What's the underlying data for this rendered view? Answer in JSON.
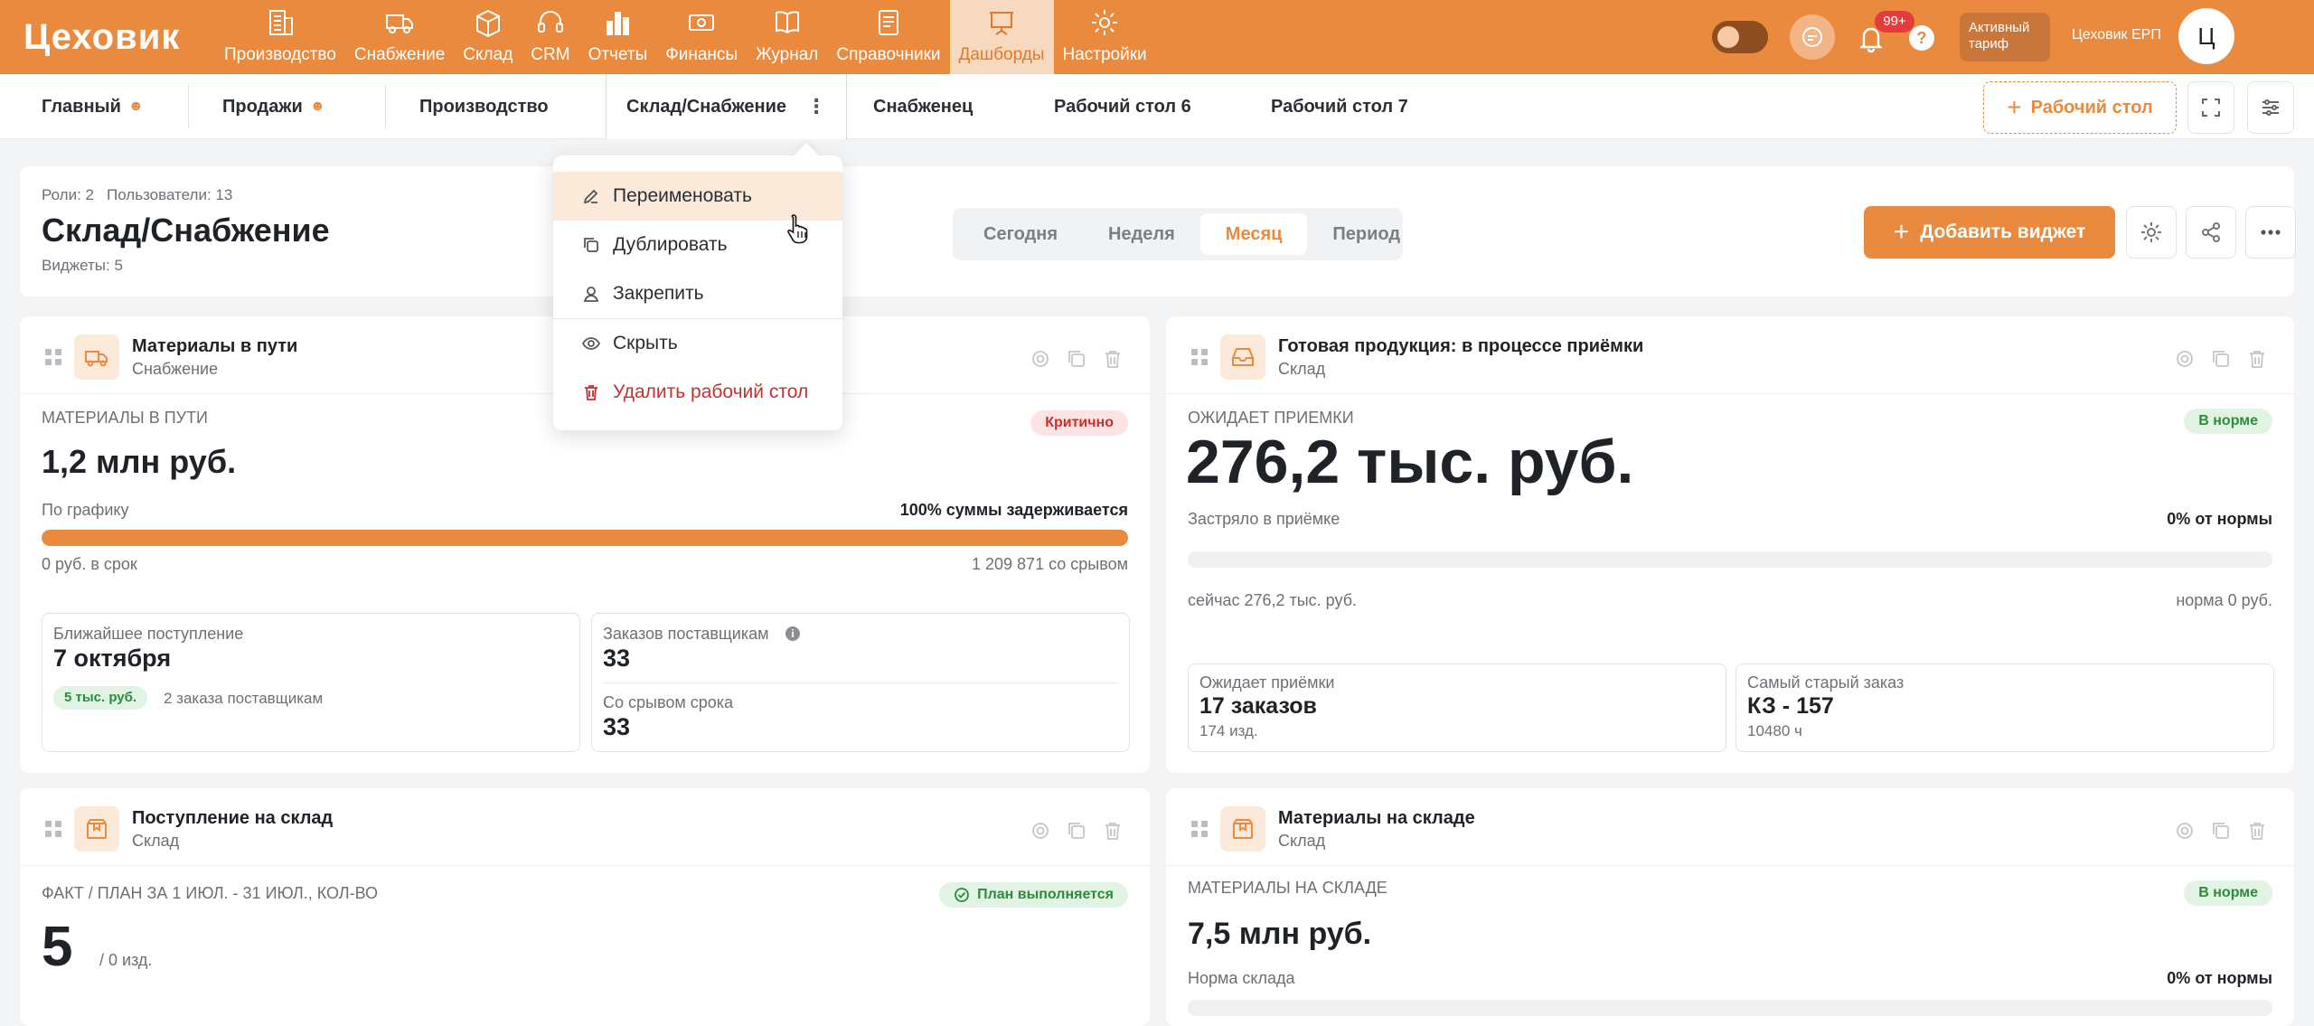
{
  "app": {
    "logo_text": "Цеховик",
    "nav": [
      {
        "label": "Производство",
        "icon": "building-icon"
      },
      {
        "label": "Снабжение",
        "icon": "truck-icon"
      },
      {
        "label": "Склад",
        "icon": "box-icon"
      },
      {
        "label": "CRM",
        "icon": "headset-icon"
      },
      {
        "label": "Отчеты",
        "icon": "bar-chart-icon"
      },
      {
        "label": "Финансы",
        "icon": "money-icon"
      },
      {
        "label": "Журнал",
        "icon": "book-icon"
      },
      {
        "label": "Справочники",
        "icon": "document-icon"
      },
      {
        "label": "Дашборды",
        "icon": "easel-icon",
        "active": true
      },
      {
        "label": "Настройки",
        "icon": "gear-icon"
      }
    ],
    "notifications_badge": "99+",
    "help_label": "?",
    "tariff_label": "Активный тариф",
    "company_name": "Цеховик ЕРП",
    "avatar_letter": "Ц",
    "accent_color": "#e98a3f"
  },
  "tabs": {
    "items": [
      "Главный",
      "Продажи",
      "Производство",
      "Склад/Снабжение",
      "Снабженец",
      "Рабочий стол 6",
      "Рабочий стол 7"
    ],
    "kebab": "⋮",
    "add_label": "Рабочий стол"
  },
  "menu": {
    "items": [
      "Переименовать",
      "Дублировать",
      "Закрепить",
      "Скрыть",
      "Удалить рабочий стол"
    ]
  },
  "header": {
    "roles": "Роли: 2",
    "users": "Пользователи: 13",
    "title": "Склад/Снабжение",
    "widgets_count": "Виджеты: 5",
    "periods": [
      "Сегодня",
      "Неделя",
      "Месяц",
      "Период"
    ],
    "active_period": "Месяц",
    "add_widget_label": "Добавить виджет"
  },
  "widgets": {
    "w1": {
      "title": "Материалы в пути",
      "subtitle": "Снабжение",
      "label": "Материалы в пути",
      "status": "Критично",
      "value": "1,2 млн руб.",
      "bar_left": "По графику",
      "bar_right": "100% суммы задерживается",
      "progress": 1.0,
      "under_left": "0 руб. в срок",
      "under_right": "1 209 871 со срывом",
      "next_label": "Ближайшее поступление",
      "next_value": "7 октября",
      "next_pill": "5 тыс. руб.",
      "next_note": "2 заказа поставщикам",
      "orders_label": "Заказов поставщикам",
      "orders_value": "33",
      "late_label": "Со срывом срока",
      "late_value": "33"
    },
    "w2": {
      "title": "Готовая продукция: в процессе приёмки",
      "subtitle": "Склад",
      "label": "Ожидает приемки",
      "status": "В норме",
      "value": "276,2 тыс. руб.",
      "bar_left": "Застряло в приёмке",
      "bar_right": "0% от нормы",
      "progress": 0.0,
      "under_left": "сейчас 276,2 тыс. руб.",
      "under_right": "норма 0 руб.",
      "box1_label": "Ожидает приёмки",
      "box1_value": "17 заказов",
      "box1_note": "174 изд.",
      "box2_label": "Самый старый заказ",
      "box2_value": "КЗ - 157",
      "box2_note": "10480 ч"
    },
    "w3": {
      "title": "Поступление на склад",
      "subtitle": "Склад",
      "label": "Факт / план за 1 июл. - 31 июл., кол-во",
      "status": "План выполняется",
      "value": "5",
      "value_note": "/ 0 изд."
    },
    "w4": {
      "title": "Материалы на складе",
      "subtitle": "Склад",
      "label": "Материалы на складе",
      "status": "В норме",
      "value": "7,5 млн руб.",
      "bar_left": "Норма склада",
      "bar_right": "0% от нормы"
    }
  }
}
